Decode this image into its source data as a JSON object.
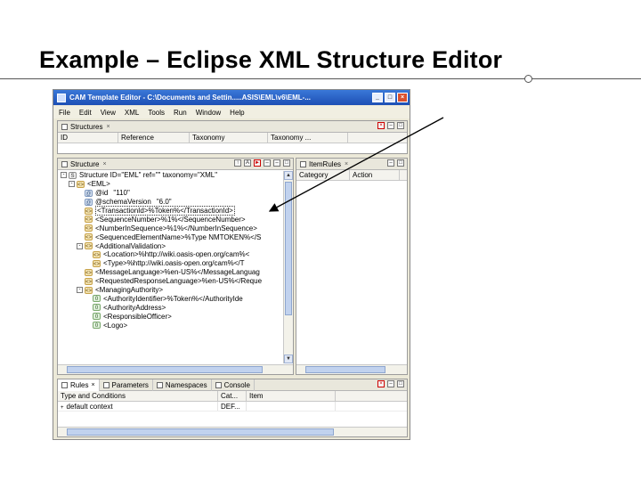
{
  "slide": {
    "title": "Example – Eclipse XML Structure Editor"
  },
  "window": {
    "title": "CAM Template Editor - C:\\Documents and Settin.....ASIS\\EML\\v6\\EML-...",
    "buttons": [
      "_",
      "□",
      "×"
    ],
    "menu": [
      "File",
      "Edit",
      "View",
      "XML",
      "Tools",
      "Run",
      "Window",
      "Help"
    ]
  },
  "structures_view": {
    "tab_label": "Structures",
    "columns": [
      "ID",
      "Reference",
      "Taxonomy",
      "Taxonomy ..."
    ]
  },
  "structure_view": {
    "tab_label": "Structure",
    "tree": [
      {
        "exp": "-",
        "icon": "dt",
        "icon_glyph": "S",
        "indent": 0,
        "label": "Structure ID=\"EML\" ref=\"\" taxonomy=\"XML\""
      },
      {
        "exp": "-",
        "icon": "el",
        "icon_glyph": "<>",
        "indent": 1,
        "label": "<EML>"
      },
      {
        "exp": "",
        "icon": "at",
        "icon_glyph": "@",
        "indent": 2,
        "label": "@id",
        "value": "\"110\""
      },
      {
        "exp": "",
        "icon": "at",
        "icon_glyph": "@",
        "indent": 2,
        "label": "@schemaVersion",
        "value": "\"6.0\""
      },
      {
        "exp": "",
        "icon": "el",
        "icon_glyph": "<>",
        "indent": 2,
        "label": "<TransactionId>%Token%</TransactionId>",
        "selected": true
      },
      {
        "exp": "",
        "icon": "el",
        "icon_glyph": "<>",
        "indent": 2,
        "label": "<SequenceNumber>%1%</SequenceNumber>"
      },
      {
        "exp": "",
        "icon": "el",
        "icon_glyph": "<>",
        "indent": 2,
        "label": "<NumberInSequence>%1%</NumberInSequence>"
      },
      {
        "exp": "",
        "icon": "el",
        "icon_glyph": "<>",
        "indent": 2,
        "label": "<SequencedElementName>%Type NMTOKEN%</S"
      },
      {
        "exp": "-",
        "icon": "el",
        "icon_glyph": "<>",
        "indent": 2,
        "label": "<AdditionalValidation>"
      },
      {
        "exp": "",
        "icon": "el",
        "icon_glyph": "<>",
        "indent": 3,
        "label": "<Location>%http://wiki.oasis-open.org/cam%<"
      },
      {
        "exp": "",
        "icon": "el",
        "icon_glyph": "<>",
        "indent": 3,
        "label": "<Type>%http://wiki.oasis-open.org/cam%</T"
      },
      {
        "exp": "",
        "icon": "el",
        "icon_glyph": "<>",
        "indent": 2,
        "label": "<MessageLanguage>%en-US%</MessageLanguag"
      },
      {
        "exp": "",
        "icon": "el",
        "icon_glyph": "<>",
        "indent": 2,
        "label": "<RequestedResponseLanguage>%en-US%</Reque"
      },
      {
        "exp": "-",
        "icon": "el",
        "icon_glyph": "<>",
        "indent": 2,
        "label": "<ManagingAuthority>"
      },
      {
        "exp": "",
        "icon": "rt",
        "icon_glyph": "0",
        "indent": 3,
        "label": "<AuthorityIdentifier>%Token%</AuthorityIde"
      },
      {
        "exp": "",
        "icon": "rt",
        "icon_glyph": "0",
        "indent": 3,
        "label": "<AuthorityAddress>"
      },
      {
        "exp": "",
        "icon": "rt",
        "icon_glyph": "0",
        "indent": 3,
        "label": "<ResponsibleOfficer>"
      },
      {
        "exp": "",
        "icon": "rt",
        "icon_glyph": "0",
        "indent": 3,
        "label": "<Logo>"
      }
    ]
  },
  "item_rules_view": {
    "tab_label": "ItemRules",
    "columns": [
      "Category",
      "Action"
    ]
  },
  "bottom_view": {
    "tabs": [
      "Rules",
      "Parameters",
      "Namespaces",
      "Console"
    ],
    "columns": [
      "Type and Conditions",
      "Cat...",
      "Item"
    ],
    "rows": [
      {
        "type": "default context",
        "cat": "DEF...",
        "item": ""
      }
    ]
  },
  "colors": {
    "titlebar": "#1d4fb5",
    "chrome": "#ece9d8",
    "selection_border": "#333333"
  }
}
